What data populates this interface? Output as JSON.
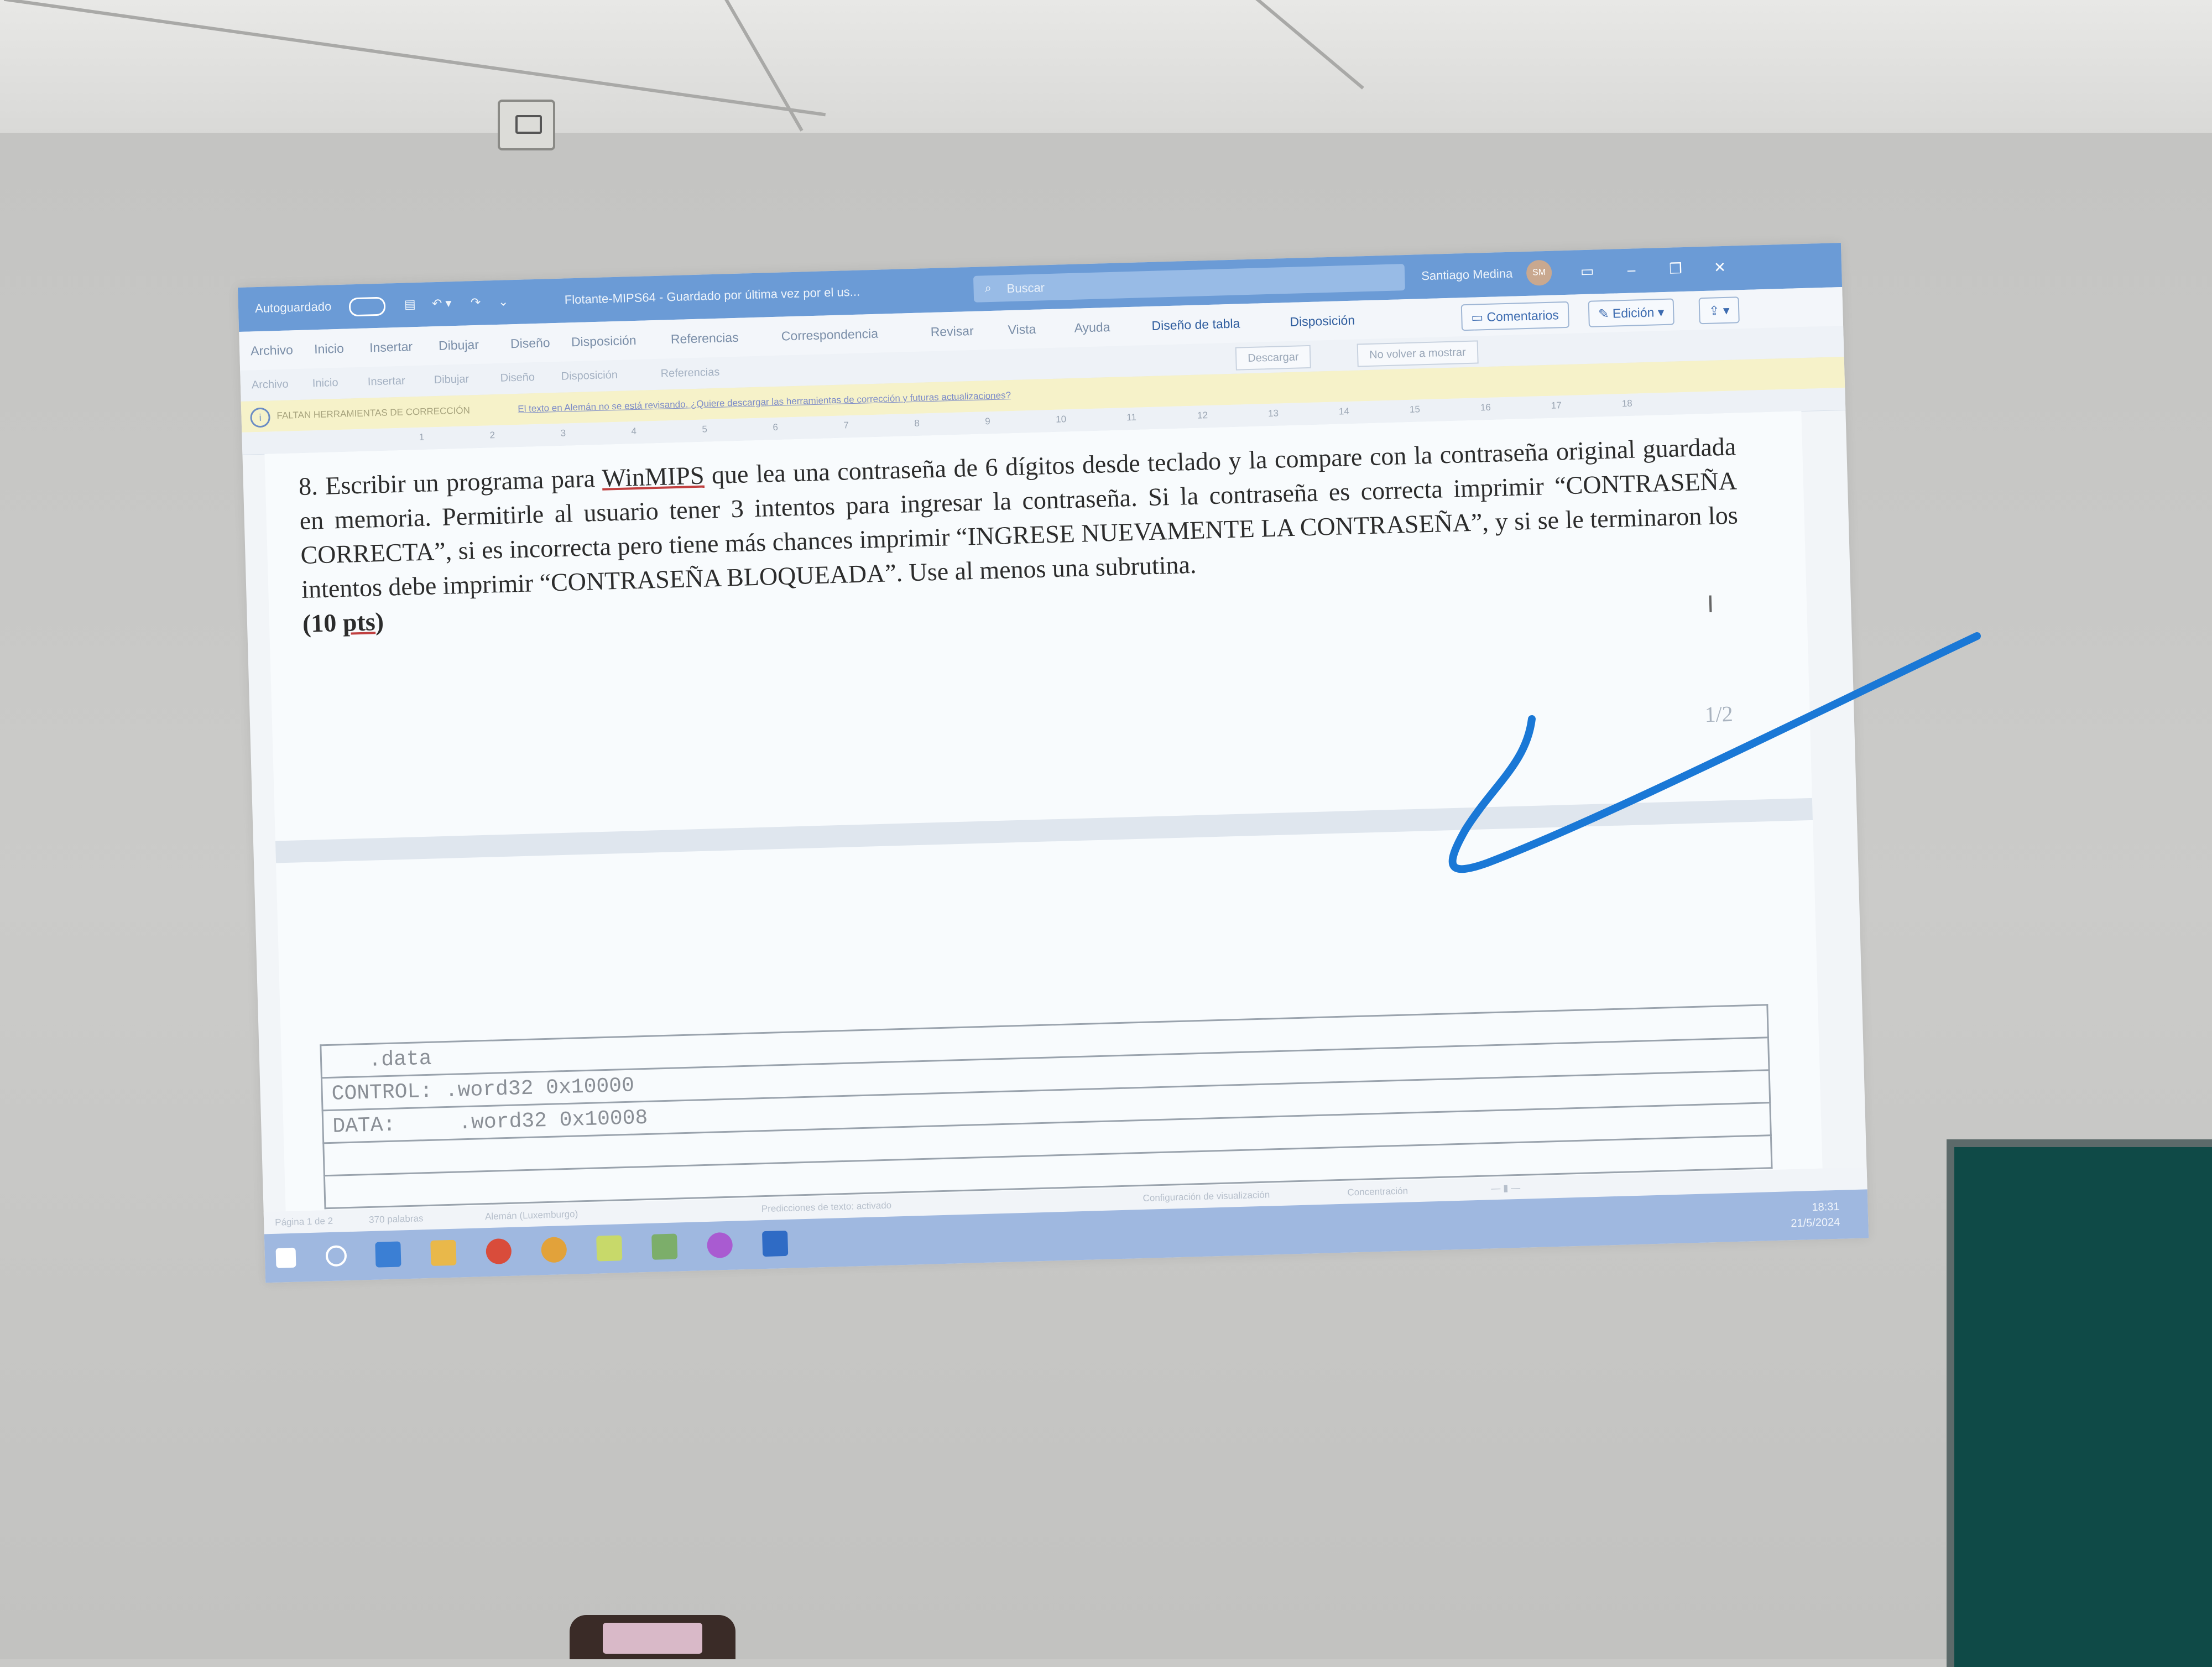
{
  "titlebar": {
    "autosave": "Autoguardado",
    "doc_title": "Flotante-MIPS64 - Guardado por última vez por el us...",
    "search_placeholder": "Buscar",
    "user": "Santiago Medina",
    "avatar_initials": "SM"
  },
  "menu": {
    "items": [
      "Archivo",
      "Inicio",
      "Insertar",
      "Dibujar",
      "Diseño",
      "Disposición",
      "Referencias",
      "Correspondencia",
      "Revisar",
      "Vista",
      "Ayuda",
      "Diseño de tabla",
      "Disposición"
    ],
    "comments_label": "Comentarios",
    "edit_label": "Edición"
  },
  "ribbon": {
    "download_label": "Descargar",
    "dismiss_label": "No volver a mostrar"
  },
  "infobar": {
    "title": "FALTAN HERRAMIENTAS DE CORRECCIÓN",
    "message": "El texto en Alemán no se está revisando. ¿Quiere descargar las herramientas de corrección y futuras actualizaciones?"
  },
  "ruler": [
    "1",
    "2",
    "3",
    "4",
    "5",
    "6",
    "7",
    "8",
    "9",
    "10",
    "11",
    "12",
    "13",
    "14",
    "15",
    "16",
    "17",
    "18"
  ],
  "document": {
    "question_number": "8.",
    "question_pre": "Escribir un programa para",
    "question_link": "WinMIPS",
    "question_post": "que lea una contraseña de 6 dígitos desde teclado y la compare con la contraseña original guardada en memoria. Permitirle al usuario tener 3 intentos para ingresar la contraseña. Si la contraseña es correcta imprimir “CONTRASEÑA CORRECTA”, si es incorrecta pero tiene más chances imprimir “INGRESE NUEVAMENTE LA CONTRASEÑA”, y si se le terminaron los intentos debe imprimir “CONTRASEÑA BLOQUEADA”. Use al menos una subrutina.",
    "points_open": "(10 ",
    "points_word": "pts",
    "points_close": ")",
    "page_number": "1/2",
    "code_rows": [
      "   .data",
      "CONTROL: .word32 0x10000",
      "DATA:     .word32 0x10008",
      "",
      ""
    ]
  },
  "statusbar": {
    "page": "Página 1 de 2",
    "words": "370 palabras",
    "language": "Alemán (Luxemburgo)",
    "predictions": "Predicciones de texto: activado",
    "display_settings": "Configuración de visualización",
    "focus": "Concentración"
  },
  "taskbar": {
    "time": "18:31",
    "date": "21/5/2024"
  },
  "colors": {
    "titlebar": "#6b9bd6",
    "annotation_stroke": "#1a78d6",
    "board": "#0f4a47"
  }
}
